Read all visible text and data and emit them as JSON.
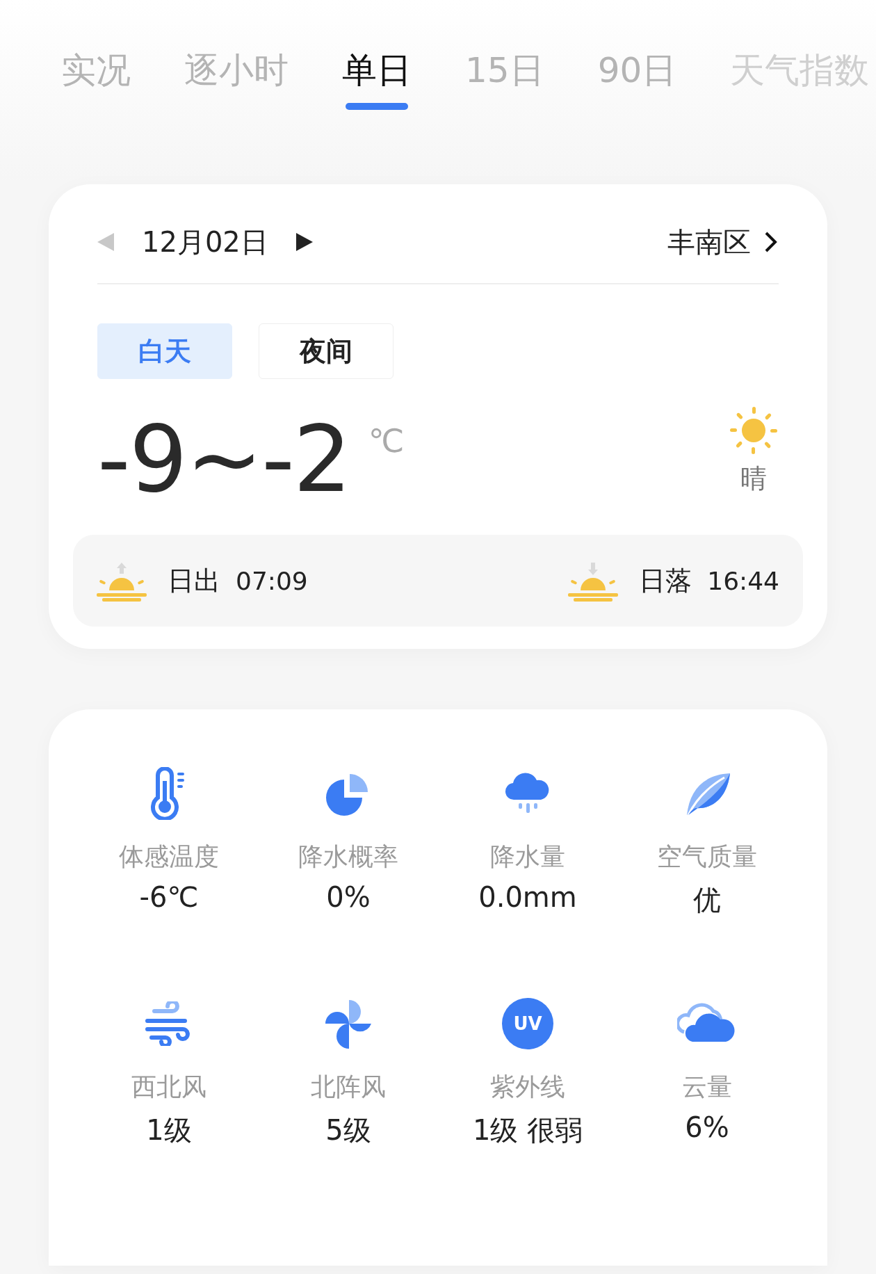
{
  "tabs": [
    {
      "label": "实况",
      "selected": false
    },
    {
      "label": "逐小时",
      "selected": false
    },
    {
      "label": "单日",
      "selected": true
    },
    {
      "label": "15日",
      "selected": false
    },
    {
      "label": "90日",
      "selected": false
    },
    {
      "label": "天气指数",
      "selected": false
    }
  ],
  "day_card": {
    "date": "12月02日",
    "prev": {
      "disabled": true
    },
    "next": {
      "disabled": false
    },
    "location": "丰南区",
    "periods": [
      {
        "label": "白天",
        "selected": true
      },
      {
        "label": "夜间",
        "selected": false
      }
    ],
    "temperature": "-9~-2",
    "unit": "℃",
    "condition": "晴",
    "sun_events": [
      {
        "kind": "sunrise",
        "label": "日出",
        "time": "07:09"
      },
      {
        "kind": "sunset",
        "label": "日落",
        "time": "16:44"
      }
    ]
  },
  "details": [
    {
      "kind": "feels_like",
      "label": "体感温度",
      "value": "-6℃"
    },
    {
      "kind": "precip_chance",
      "label": "降水概率",
      "value": "0%"
    },
    {
      "kind": "precip_amount",
      "label": "降水量",
      "value": "0.0mm"
    },
    {
      "kind": "air_quality",
      "label": "空气质量",
      "value": "优"
    },
    {
      "kind": "wind",
      "label": "西北风",
      "value": "1级"
    },
    {
      "kind": "gust",
      "label": "北阵风",
      "value": "5级"
    },
    {
      "kind": "uv",
      "label": "紫外线",
      "value": "1级 很弱",
      "badge": "UV"
    },
    {
      "kind": "cloud",
      "label": "云量",
      "value": "6%"
    }
  ]
}
